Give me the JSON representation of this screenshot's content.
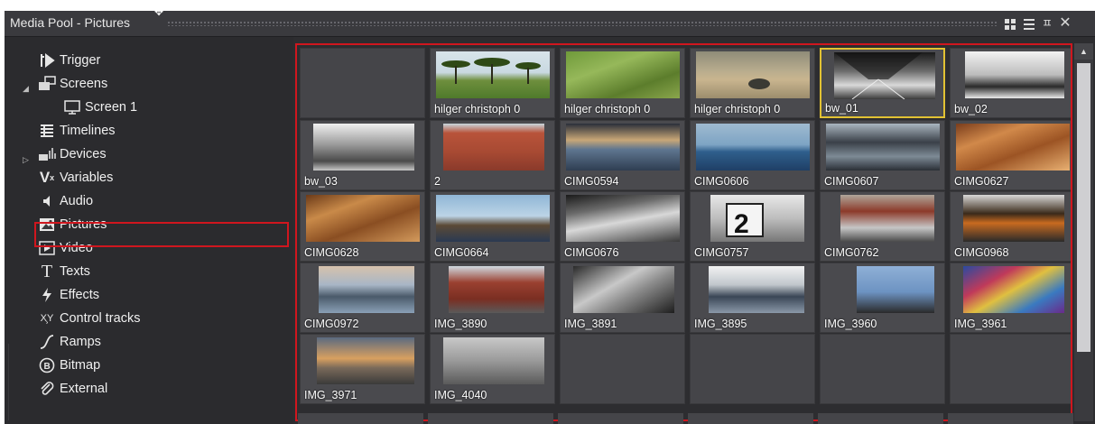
{
  "panel": {
    "title": "Media Pool - Pictures",
    "toolbar": {
      "grid_view_icon": "grid-view-icon",
      "list_view_icon": "list-view-icon",
      "pin_glyph": "ㅍ",
      "close_glyph": "✕"
    }
  },
  "tree": {
    "items": [
      {
        "label": "Trigger",
        "icon": "trigger-icon"
      },
      {
        "label": "Screens",
        "icon": "screens-icon",
        "expanded": true
      },
      {
        "label": "Screen 1",
        "icon": "screen-icon"
      },
      {
        "label": "Timelines",
        "icon": "timelines-icon"
      },
      {
        "label": "Devices",
        "icon": "devices-icon",
        "expanded": false
      },
      {
        "label": "Variables",
        "icon": "variables-icon"
      },
      {
        "label": "Audio",
        "icon": "audio-icon"
      },
      {
        "label": "Pictures",
        "icon": "pictures-icon",
        "selected": true
      },
      {
        "label": "Video",
        "icon": "video-icon"
      },
      {
        "label": "Texts",
        "icon": "texts-icon"
      },
      {
        "label": "Effects",
        "icon": "effects-icon"
      },
      {
        "label": "Control tracks",
        "icon": "control-tracks-icon"
      },
      {
        "label": "Ramps",
        "icon": "ramps-icon"
      },
      {
        "label": "Bitmap",
        "icon": "bitmap-icon"
      },
      {
        "label": "External",
        "icon": "external-icon"
      }
    ]
  },
  "grid": {
    "cells": [
      "",
      "hilger christoph 0",
      "hilger christoph 0",
      "hilger christoph 0",
      "bw_01",
      "bw_02",
      "bw_03",
      "2",
      "CIMG0594",
      "CIMG0606",
      "CIMG0607",
      "CIMG0627",
      "CIMG0628",
      "CIMG0664",
      "CIMG0676",
      "CIMG0757",
      "CIMG0762",
      "CIMG0968",
      "CIMG0972",
      "IMG_3890",
      "IMG_3891",
      "IMG_3895",
      "IMG_3960",
      "IMG_3961",
      "IMG_3971",
      "IMG_4040",
      "",
      "",
      "",
      ""
    ],
    "selected": "bw_01"
  },
  "colors": {
    "selection_red": "#d0161e",
    "selected_cell": "#e2c233",
    "panel_bg": "#2d2d30"
  }
}
